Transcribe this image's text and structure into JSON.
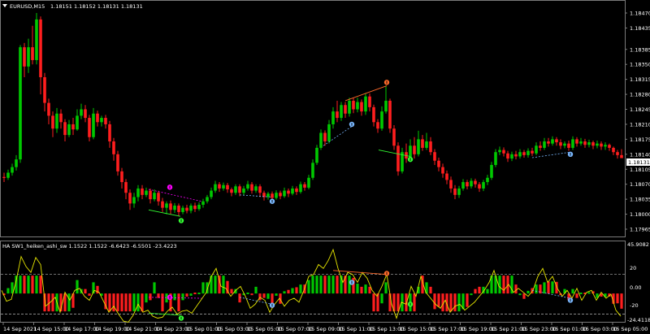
{
  "main_header": {
    "symbol_tf": "EURUSD,M15",
    "ohlc": "1.18151 1.18152 1.18131 1.18131"
  },
  "main_price_axis": [
    "1.18470",
    "1.18435",
    "1.18385",
    "1.18350",
    "1.18315",
    "1.18280",
    "1.18245",
    "1.18210",
    "1.18175",
    "1.18140",
    "1.18105",
    "1.18070",
    "1.18035",
    "1.18000",
    "1.17965"
  ],
  "current_price": "1.18131",
  "indicator_header": "HA SW1_heiken_ashi_sw 1.1522 1.1522 -6.6423 -6.5501 -23.4223",
  "indicator_axis": {
    "top": "45.9082",
    "upper": "20",
    "mid": "0.00",
    "lower": "-20",
    "bottom": "-24.4118"
  },
  "time_axis": [
    "14 Sep 2021",
    "14 Sep 15:00",
    "14 Sep 17:00",
    "14 Sep 19:00",
    "14 Sep 21:00",
    "14 Sep 23:00",
    "15 Sep 01:00",
    "15 Sep 03:00",
    "15 Sep 05:00",
    "15 Sep 07:00",
    "15 Sep 09:00",
    "15 Sep 11:00",
    "15 Sep 13:00",
    "15 Sep 15:00",
    "15 Sep 17:00",
    "15 Sep 19:00",
    "15 Sep 21:00",
    "15 Sep 23:00",
    "16 Sep 01:00",
    "16 Sep 03:00",
    "16 Sep 05:00"
  ],
  "colors": {
    "bull": "#00c800",
    "bear": "#ff1e1e",
    "osc_line": "#e6e600",
    "level_line": "#b4b4b4",
    "divergence_bull": "#7ab8ff",
    "divergence_bear": "#ff6a2a",
    "signal_magenta": "#ff00ff",
    "signal_lime": "#33ff33"
  },
  "candles": [
    [
      5,
      1.18087,
      1.18085,
      1.18097,
      1.18075
    ],
    [
      10,
      1.18085,
      1.18097,
      1.18104,
      1.1808
    ],
    [
      15,
      1.18097,
      1.1811,
      1.18118,
      1.1809
    ],
    [
      20,
      1.1811,
      1.18128,
      1.18138,
      1.18102
    ],
    [
      25,
      1.18128,
      1.1839,
      1.18395,
      1.1812
    ],
    [
      30,
      1.1839,
      1.18345,
      1.184,
      1.1832
    ],
    [
      35,
      1.18345,
      1.1839,
      1.1841,
      1.1833
    ],
    [
      40,
      1.1839,
      1.1836,
      1.1844,
      1.1835
    ],
    [
      45,
      1.1836,
      1.18455,
      1.1847,
      1.1835
    ],
    [
      50,
      1.18455,
      1.1832,
      1.18462,
      1.1828
    ],
    [
      55,
      1.1832,
      1.1826,
      1.1833,
      1.1824
    ],
    [
      60,
      1.1826,
      1.1823,
      1.1827,
      1.1821
    ],
    [
      65,
      1.1823,
      1.182,
      1.1824,
      1.1818
    ],
    [
      70,
      1.182,
      1.18235,
      1.18248,
      1.1819
    ],
    [
      75,
      1.18235,
      1.18215,
      1.18245,
      1.182
    ],
    [
      80,
      1.18215,
      1.18185,
      1.18222,
      1.1817
    ],
    [
      85,
      1.18185,
      1.1821,
      1.1822,
      1.1818
    ],
    [
      90,
      1.1821,
      1.18198,
      1.18225,
      1.18185
    ],
    [
      95,
      1.18198,
      1.1823,
      1.18245,
      1.18195
    ],
    [
      100,
      1.1823,
      1.18245,
      1.18258,
      1.18222
    ],
    [
      105,
      1.18245,
      1.18225,
      1.18255,
      1.18215
    ],
    [
      110,
      1.18225,
      1.1818,
      1.18232,
      1.1817
    ],
    [
      115,
      1.1818,
      1.18235,
      1.18248,
      1.18175
    ],
    [
      120,
      1.18235,
      1.18215,
      1.18242,
      1.18205
    ],
    [
      125,
      1.18215,
      1.18225,
      1.1823,
      1.18205
    ],
    [
      130,
      1.18225,
      1.1821,
      1.18232,
      1.182
    ],
    [
      135,
      1.1821,
      1.1817,
      1.18218,
      1.18155
    ],
    [
      140,
      1.1817,
      1.1814,
      1.18178,
      1.18125
    ],
    [
      145,
      1.1814,
      1.181,
      1.18148,
      1.1809
    ],
    [
      150,
      1.181,
      1.18075,
      1.18108,
      1.1806
    ],
    [
      155,
      1.18075,
      1.1805,
      1.18082,
      1.18035
    ],
    [
      160,
      1.1805,
      1.18025,
      1.18058,
      1.1801
    ],
    [
      165,
      1.18025,
      1.1804,
      1.1805,
      1.18015
    ],
    [
      170,
      1.1804,
      1.1806,
      1.18068,
      1.1803
    ],
    [
      175,
      1.1806,
      1.18045,
      1.18068,
      1.18035
    ],
    [
      180,
      1.18045,
      1.18055,
      1.18062,
      1.1804
    ],
    [
      185,
      1.18055,
      1.18035,
      1.1806,
      1.18025
    ],
    [
      190,
      1.18035,
      1.1805,
      1.18058,
      1.1803
    ],
    [
      195,
      1.1805,
      1.1803,
      1.18055,
      1.1802
    ],
    [
      200,
      1.1803,
      1.18015,
      1.18038,
      1.18005
    ],
    [
      205,
      1.18015,
      1.18025,
      1.1803,
      1.18
    ],
    [
      210,
      1.18025,
      1.1801,
      1.18032,
      1.18
    ],
    [
      215,
      1.1801,
      1.1802,
      1.18026,
      1.18003
    ],
    [
      220,
      1.1802,
      1.18005,
      1.18025,
      1.17995
    ],
    [
      225,
      1.18005,
      1.18015,
      1.1802,
      1.18
    ],
    [
      230,
      1.18015,
      1.18008,
      1.18022,
      1.18002
    ],
    [
      235,
      1.18008,
      1.1802,
      1.18025,
      1.18002
    ],
    [
      240,
      1.1802,
      1.18012,
      1.18027,
      1.18005
    ],
    [
      245,
      1.18012,
      1.18022,
      1.18028,
      1.18008
    ],
    [
      250,
      1.18022,
      1.1803,
      1.18036,
      1.18015
    ],
    [
      255,
      1.1803,
      1.1804,
      1.18045,
      1.18025
    ],
    [
      260,
      1.1804,
      1.18055,
      1.18062,
      1.18035
    ],
    [
      265,
      1.18055,
      1.1807,
      1.18078,
      1.1805
    ],
    [
      270,
      1.1807,
      1.1806,
      1.18075,
      1.18052
    ],
    [
      275,
      1.1806,
      1.18068,
      1.18074,
      1.18055
    ],
    [
      280,
      1.18068,
      1.18058,
      1.18073,
      1.1805
    ],
    [
      285,
      1.18058,
      1.1805,
      1.18062,
      1.18042
    ],
    [
      290,
      1.1805,
      1.18065,
      1.1807,
      1.18045
    ],
    [
      295,
      1.18065,
      1.1805,
      1.1807,
      1.18042
    ],
    [
      300,
      1.1805,
      1.1806,
      1.18066,
      1.18044
    ],
    [
      305,
      1.1806,
      1.1807,
      1.18078,
      1.18055
    ],
    [
      310,
      1.1807,
      1.18055,
      1.18075,
      1.18048
    ],
    [
      315,
      1.18055,
      1.18065,
      1.1807,
      1.1805
    ],
    [
      320,
      1.18065,
      1.1805,
      1.1807,
      1.1804
    ],
    [
      325,
      1.1805,
      1.1804,
      1.18055,
      1.18032
    ],
    [
      330,
      1.1804,
      1.18048,
      1.18052,
      1.18034
    ],
    [
      335,
      1.18048,
      1.18038,
      1.18053,
      1.1803
    ],
    [
      340,
      1.18038,
      1.1805,
      1.18056,
      1.18034
    ],
    [
      345,
      1.1805,
      1.18042,
      1.18055,
      1.18035
    ],
    [
      350,
      1.18042,
      1.18055,
      1.18062,
      1.18038
    ],
    [
      355,
      1.18055,
      1.18048,
      1.1806,
      1.1804
    ],
    [
      360,
      1.18048,
      1.1806,
      1.18066,
      1.18044
    ],
    [
      365,
      1.1806,
      1.18052,
      1.18065,
      1.18045
    ],
    [
      370,
      1.18052,
      1.1807,
      1.18076,
      1.18048
    ],
    [
      375,
      1.1807,
      1.18062,
      1.18075,
      1.18055
    ],
    [
      380,
      1.18062,
      1.18085,
      1.18092,
      1.18058
    ],
    [
      385,
      1.18085,
      1.1812,
      1.18128,
      1.1808
    ],
    [
      390,
      1.1812,
      1.18155,
      1.18162,
      1.18115
    ],
    [
      395,
      1.18155,
      1.1819,
      1.18198,
      1.1815
    ],
    [
      400,
      1.1819,
      1.1817,
      1.18196,
      1.1816
    ],
    [
      405,
      1.1817,
      1.1821,
      1.1822,
      1.18165
    ],
    [
      410,
      1.1821,
      1.1824,
      1.1825,
      1.182
    ],
    [
      415,
      1.1824,
      1.18225,
      1.18265,
      1.18215
    ],
    [
      420,
      1.18225,
      1.18255,
      1.18262,
      1.18218
    ],
    [
      425,
      1.18255,
      1.18235,
      1.18262,
      1.18225
    ],
    [
      430,
      1.18235,
      1.18265,
      1.18272,
      1.18228
    ],
    [
      435,
      1.18265,
      1.18245,
      1.18272,
      1.18236
    ],
    [
      440,
      1.18245,
      1.18262,
      1.18272,
      1.18238
    ],
    [
      445,
      1.18262,
      1.1824,
      1.18268,
      1.1823
    ],
    [
      450,
      1.1824,
      1.18275,
      1.18282,
      1.18232
    ],
    [
      455,
      1.18275,
      1.1825,
      1.18282,
      1.1824
    ],
    [
      460,
      1.1825,
      1.18215,
      1.18256,
      1.18205
    ],
    [
      465,
      1.18215,
      1.182,
      1.18222,
      1.1819
    ],
    [
      470,
      1.182,
      1.1824,
      1.18252,
      1.18195
    ],
    [
      475,
      1.1824,
      1.18265,
      1.183,
      1.18235
    ],
    [
      480,
      1.18265,
      1.182,
      1.1827,
      1.1819
    ],
    [
      485,
      1.182,
      1.1816,
      1.18208,
      1.1815
    ],
    [
      490,
      1.1816,
      1.181,
      1.18168,
      1.1809
    ],
    [
      495,
      1.181,
      1.18145,
      1.18155,
      1.18095
    ],
    [
      500,
      1.18145,
      1.1813,
      1.18165,
      1.1812
    ],
    [
      505,
      1.1813,
      1.1816,
      1.18175,
      1.18125
    ],
    [
      510,
      1.1816,
      1.1814,
      1.1818,
      1.1813
    ],
    [
      515,
      1.1814,
      1.18175,
      1.18195,
      1.18135
    ],
    [
      520,
      1.18175,
      1.18155,
      1.18185,
      1.18148
    ],
    [
      525,
      1.18155,
      1.1817,
      1.1819,
      1.1815
    ],
    [
      530,
      1.1817,
      1.18145,
      1.1818,
      1.18138
    ],
    [
      535,
      1.18145,
      1.18125,
      1.18152,
      1.18115
    ],
    [
      540,
      1.18125,
      1.1811,
      1.18132,
      1.181
    ],
    [
      545,
      1.1811,
      1.18095,
      1.18118,
      1.18085
    ],
    [
      550,
      1.18095,
      1.1808,
      1.18102,
      1.1807
    ],
    [
      555,
      1.1808,
      1.1806,
      1.18088,
      1.1805
    ],
    [
      560,
      1.1806,
      1.18045,
      1.18068,
      1.18035
    ],
    [
      565,
      1.18045,
      1.1806,
      1.18066,
      1.18038
    ],
    [
      570,
      1.1806,
      1.18075,
      1.18082,
      1.18055
    ],
    [
      575,
      1.18075,
      1.18065,
      1.1808,
      1.18058
    ],
    [
      580,
      1.18065,
      1.18078,
      1.18084,
      1.1806
    ],
    [
      585,
      1.18078,
      1.1807,
      1.18083,
      1.18062
    ],
    [
      590,
      1.1807,
      1.1806,
      1.18075,
      1.18052
    ],
    [
      595,
      1.1806,
      1.18075,
      1.1808,
      1.18054
    ],
    [
      600,
      1.18075,
      1.18085,
      1.18092,
      1.18068
    ],
    [
      605,
      1.18085,
      1.18115,
      1.18122,
      1.1808
    ],
    [
      610,
      1.18115,
      1.18145,
      1.18152,
      1.1811
    ],
    [
      615,
      1.18145,
      1.1815,
      1.18158,
      1.18138
    ],
    [
      620,
      1.1815,
      1.18142,
      1.18156,
      1.18135
    ],
    [
      625,
      1.18142,
      1.1813,
      1.18148,
      1.18122
    ],
    [
      630,
      1.1813,
      1.1814,
      1.18146,
      1.18124
    ],
    [
      635,
      1.1814,
      1.18135,
      1.18148,
      1.18128
    ],
    [
      640,
      1.18135,
      1.18145,
      1.18152,
      1.1813
    ],
    [
      645,
      1.18145,
      1.18138,
      1.1815,
      1.18132
    ],
    [
      650,
      1.18138,
      1.18148,
      1.18154,
      1.18132
    ],
    [
      655,
      1.18148,
      1.18142,
      1.18155,
      1.18136
    ],
    [
      660,
      1.18142,
      1.1816,
      1.18168,
      1.18138
    ],
    [
      665,
      1.1816,
      1.18155,
      1.1817,
      1.18148
    ],
    [
      670,
      1.18155,
      1.1817,
      1.18178,
      1.1815
    ],
    [
      675,
      1.1817,
      1.18165,
      1.18178,
      1.18158
    ],
    [
      680,
      1.18165,
      1.18175,
      1.18182,
      1.1816
    ],
    [
      685,
      1.18175,
      1.18168,
      1.1818,
      1.1816
    ],
    [
      690,
      1.18168,
      1.1816,
      1.18175,
      1.18152
    ],
    [
      695,
      1.1816,
      1.18165,
      1.1817,
      1.18154
    ],
    [
      700,
      1.18165,
      1.18155,
      1.18172,
      1.18148
    ],
    [
      705,
      1.18155,
      1.18175,
      1.18182,
      1.1815
    ],
    [
      710,
      1.18175,
      1.18165,
      1.1818,
      1.18158
    ],
    [
      715,
      1.18165,
      1.1817,
      1.18178,
      1.1816
    ],
    [
      720,
      1.1817,
      1.18162,
      1.18176,
      1.18155
    ],
    [
      725,
      1.18162,
      1.18168,
      1.18174,
      1.18156
    ],
    [
      730,
      1.18168,
      1.1816,
      1.18172,
      1.18152
    ],
    [
      735,
      1.1816,
      1.18165,
      1.18172,
      1.18154
    ],
    [
      740,
      1.18165,
      1.18158,
      1.1817,
      1.1815
    ],
    [
      745,
      1.18158,
      1.18162,
      1.18168,
      1.1815
    ],
    [
      750,
      1.18162,
      1.18155,
      1.18165,
      1.18148
    ],
    [
      755,
      1.18155,
      1.18145,
      1.18158,
      1.18138
    ],
    [
      760,
      1.18145,
      1.18138,
      1.1815,
      1.1813
    ],
    [
      765,
      1.18138,
      1.18131,
      1.18152,
      1.18131
    ]
  ],
  "osc_line": [
    [
      2,
      4
    ],
    [
      8,
      -7
    ],
    [
      14,
      -5
    ],
    [
      20,
      14
    ],
    [
      26,
      38
    ],
    [
      32,
      28
    ],
    [
      38,
      22
    ],
    [
      44,
      37
    ],
    [
      50,
      30
    ],
    [
      56,
      -12
    ],
    [
      62,
      -8
    ],
    [
      68,
      -3
    ],
    [
      74,
      -18
    ],
    [
      80,
      2
    ],
    [
      86,
      -6
    ],
    [
      92,
      4
    ],
    [
      98,
      6
    ],
    [
      104,
      -2
    ],
    [
      110,
      -6
    ],
    [
      116,
      4
    ],
    [
      122,
      2
    ],
    [
      128,
      -8
    ],
    [
      134,
      -18
    ],
    [
      140,
      -12
    ],
    [
      146,
      -20
    ],
    [
      152,
      -27
    ],
    [
      158,
      -28
    ],
    [
      164,
      -21
    ],
    [
      170,
      -10
    ],
    [
      176,
      -18
    ],
    [
      182,
      -16
    ],
    [
      188,
      -22
    ],
    [
      194,
      -24
    ],
    [
      200,
      -23
    ],
    [
      206,
      -17
    ],
    [
      212,
      -13
    ],
    [
      218,
      -20
    ],
    [
      224,
      -17
    ],
    [
      230,
      -16
    ],
    [
      236,
      -19
    ],
    [
      242,
      -12
    ],
    [
      248,
      -5
    ],
    [
      254,
      2
    ],
    [
      260,
      18
    ],
    [
      266,
      26
    ],
    [
      272,
      8
    ],
    [
      278,
      6
    ],
    [
      284,
      -2
    ],
    [
      290,
      4
    ],
    [
      296,
      8
    ],
    [
      302,
      -2
    ],
    [
      308,
      -14
    ],
    [
      314,
      -10
    ],
    [
      320,
      -3
    ],
    [
      326,
      -6
    ],
    [
      332,
      -18
    ],
    [
      338,
      -10
    ],
    [
      344,
      -4
    ],
    [
      350,
      -12
    ],
    [
      356,
      -6
    ],
    [
      362,
      -4
    ],
    [
      368,
      -8
    ],
    [
      374,
      4
    ],
    [
      380,
      18
    ],
    [
      386,
      20
    ],
    [
      392,
      30
    ],
    [
      398,
      26
    ],
    [
      404,
      34
    ],
    [
      410,
      45
    ],
    [
      416,
      26
    ],
    [
      422,
      12
    ],
    [
      428,
      22
    ],
    [
      434,
      20
    ],
    [
      440,
      12
    ],
    [
      446,
      22
    ],
    [
      452,
      16
    ],
    [
      458,
      4
    ],
    [
      464,
      -2
    ],
    [
      470,
      8
    ],
    [
      476,
      20
    ],
    [
      482,
      -10
    ],
    [
      488,
      -24
    ],
    [
      494,
      -8
    ],
    [
      500,
      -10
    ],
    [
      506,
      8
    ],
    [
      512,
      -2
    ],
    [
      518,
      18
    ],
    [
      524,
      2
    ],
    [
      530,
      -4
    ],
    [
      536,
      -10
    ],
    [
      542,
      -14
    ],
    [
      548,
      -6
    ],
    [
      554,
      -18
    ],
    [
      560,
      -12
    ],
    [
      566,
      -10
    ],
    [
      572,
      -16
    ],
    [
      578,
      -12
    ],
    [
      584,
      -8
    ],
    [
      590,
      -2
    ],
    [
      596,
      4
    ],
    [
      602,
      12
    ],
    [
      608,
      24
    ],
    [
      614,
      8
    ],
    [
      620,
      4
    ],
    [
      626,
      10
    ],
    [
      632,
      2
    ],
    [
      638,
      6
    ],
    [
      644,
      2
    ],
    [
      650,
      -2
    ],
    [
      656,
      4
    ],
    [
      662,
      18
    ],
    [
      668,
      26
    ],
    [
      674,
      12
    ],
    [
      680,
      18
    ],
    [
      686,
      6
    ],
    [
      692,
      -2
    ],
    [
      698,
      4
    ],
    [
      704,
      -4
    ],
    [
      710,
      6
    ],
    [
      716,
      -6
    ],
    [
      722,
      2
    ],
    [
      728,
      4
    ],
    [
      734,
      -6
    ],
    [
      740,
      2
    ],
    [
      746,
      -4
    ],
    [
      752,
      0
    ],
    [
      758,
      -16
    ],
    [
      764,
      -22
    ]
  ]
}
